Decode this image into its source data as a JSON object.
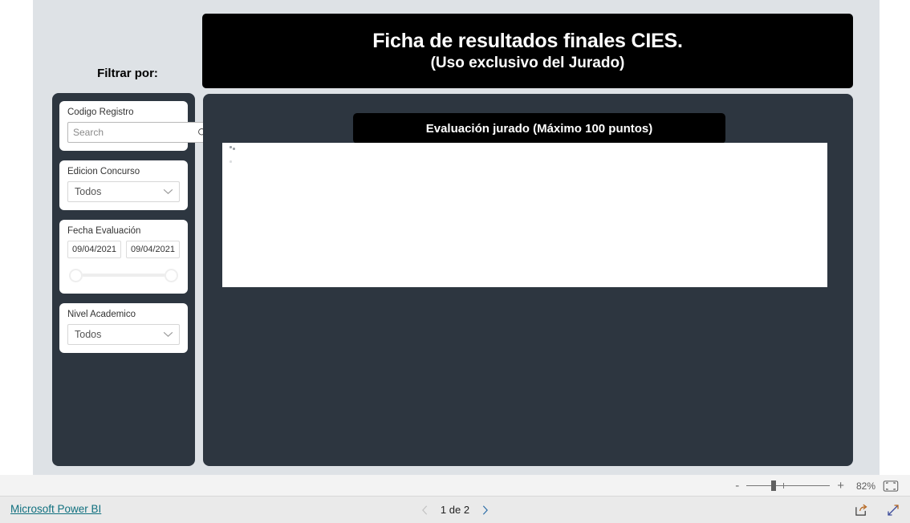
{
  "report": {
    "title_main": "Ficha de resultados finales CIES.",
    "title_sub": "(Uso exclusivo del Jurado)"
  },
  "filters": {
    "heading": "Filtrar por:",
    "codigo_registro": {
      "label": "Codigo Registro",
      "search_placeholder": "Search",
      "search_value": "",
      "search_icon": "search-icon",
      "clear_icon": "eraser-icon"
    },
    "edicion_concurso": {
      "label": "Edicion Concurso",
      "selected": "Todos",
      "chevron_icon": "chevron-down-icon"
    },
    "fecha_evaluacion": {
      "label": "Fecha Evaluación",
      "start_date": "09/04/2021",
      "end_date": "09/04/2021"
    },
    "nivel_academico": {
      "label": "Nivel Academico",
      "selected": "Todos",
      "chevron_icon": "chevron-down-icon"
    }
  },
  "main": {
    "section_title": "Evaluación jurado (Máximo 100 puntos)"
  },
  "status_bar": {
    "zoom_minus": "-",
    "zoom_plus": "+",
    "zoom_level": "82%",
    "fit_icon": "fit-to-page-icon"
  },
  "footer": {
    "brand": "Microsoft Power BI",
    "page_label": "1 de 2",
    "prev_icon": "chevron-left-icon",
    "next_icon": "chevron-right-icon",
    "share_icon": "share-icon",
    "fullscreen_icon": "fullscreen-icon"
  },
  "colors": {
    "panel_dark": "#2d3640",
    "canvas_bg": "#dee2e6",
    "banner_black": "#000000",
    "brand_teal": "#10707f"
  }
}
